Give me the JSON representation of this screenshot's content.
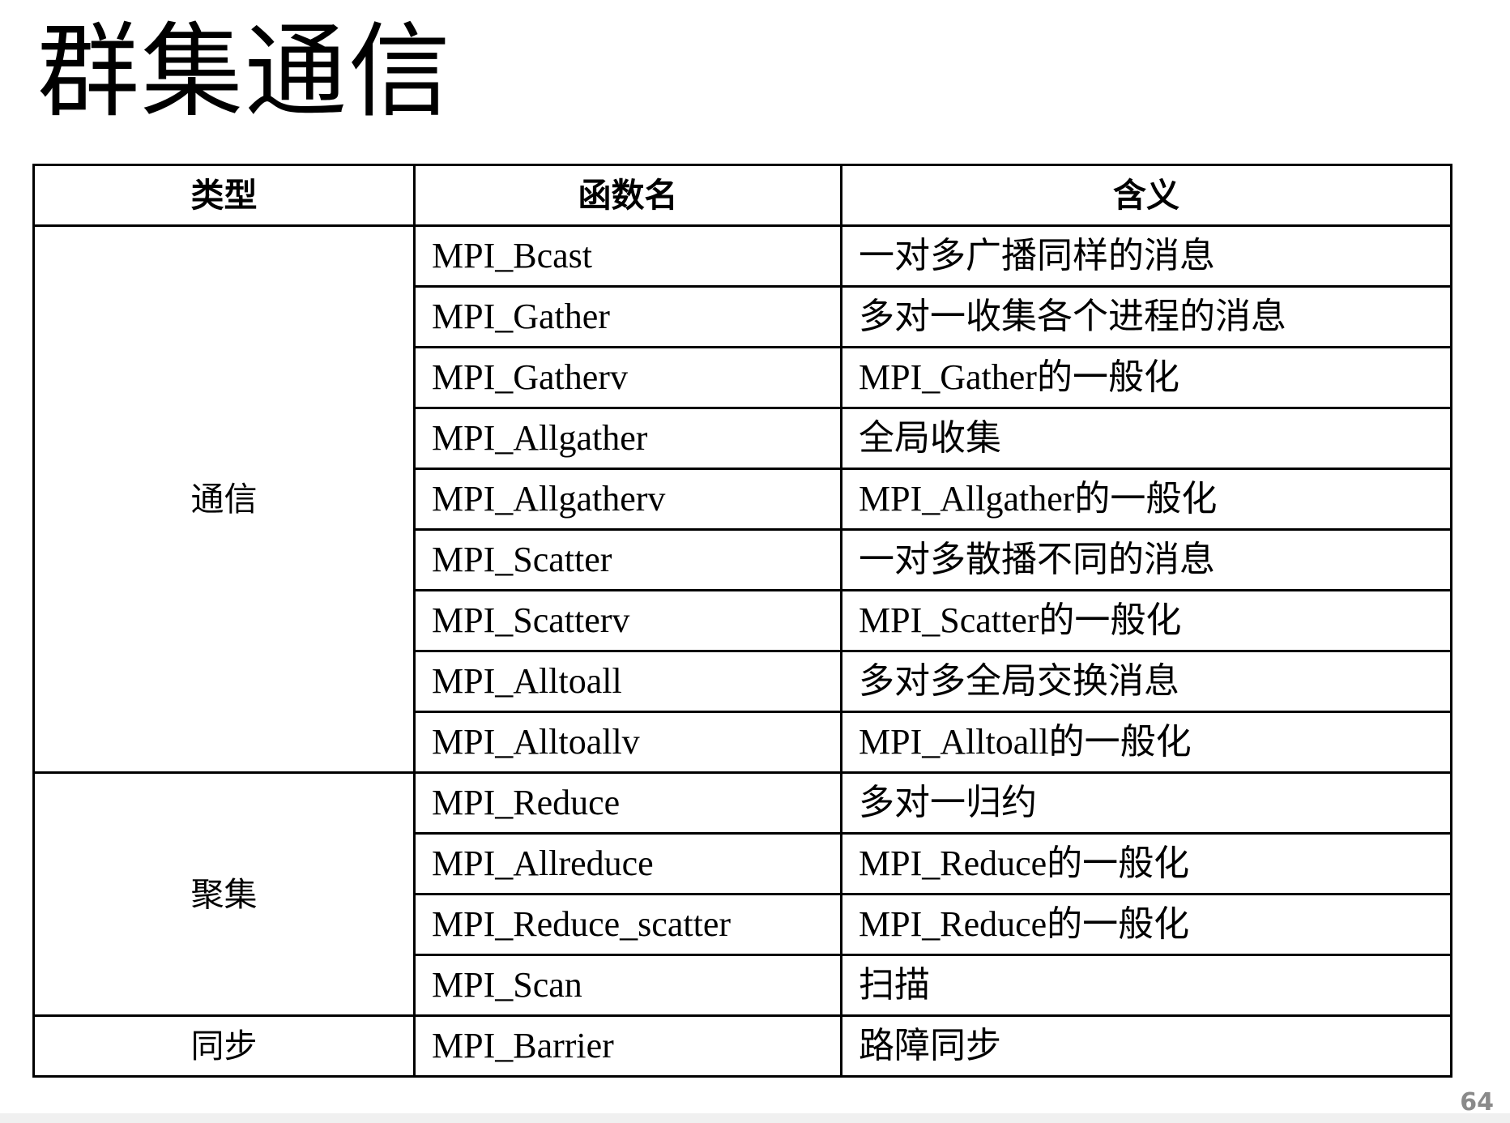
{
  "slide": {
    "title": "群集通信",
    "page_number": "64"
  },
  "table": {
    "headers": [
      "类型",
      "函数名",
      "含义"
    ],
    "groups": [
      {
        "type": "通信",
        "rows": [
          {
            "function": "MPI_Bcast",
            "meaning": "一对多广播同样的消息"
          },
          {
            "function": "MPI_Gather",
            "meaning": "多对一收集各个进程的消息"
          },
          {
            "function": "MPI_Gatherv",
            "meaning": "MPI_Gather的一般化"
          },
          {
            "function": "MPI_Allgather",
            "meaning": "全局收集"
          },
          {
            "function": "MPI_Allgatherv",
            "meaning": "MPI_Allgather的一般化"
          },
          {
            "function": "MPI_Scatter",
            "meaning": "一对多散播不同的消息"
          },
          {
            "function": "MPI_Scatterv",
            "meaning": "MPI_Scatter的一般化"
          },
          {
            "function": "MPI_Alltoall",
            "meaning": "多对多全局交换消息"
          },
          {
            "function": "MPI_Alltoallv",
            "meaning": "MPI_Alltoall的一般化"
          }
        ]
      },
      {
        "type": "聚集",
        "rows": [
          {
            "function": "MPI_Reduce",
            "meaning": "多对一归约"
          },
          {
            "function": "MPI_Allreduce",
            "meaning": "MPI_Reduce的一般化"
          },
          {
            "function": "MPI_Reduce_scatter",
            "meaning": "MPI_Reduce的一般化"
          },
          {
            "function": "MPI_Scan",
            "meaning": "扫描"
          }
        ]
      },
      {
        "type": "同步",
        "rows": [
          {
            "function": "MPI_Barrier",
            "meaning": "路障同步"
          }
        ]
      }
    ]
  }
}
